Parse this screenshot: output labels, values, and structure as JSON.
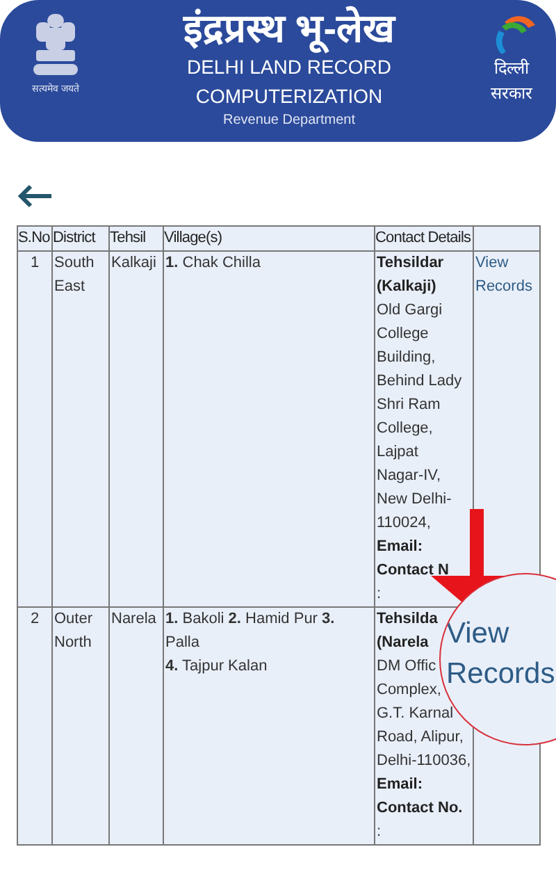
{
  "header": {
    "emblem_caption": "सत्यमेव जयते",
    "title_hindi": "इंद्रप्रस्थ भू-लेख",
    "title_lines": [
      "DELHI LAND RECORD",
      "COMPUTERIZATION"
    ],
    "subtitle": "Revenue Department",
    "logo_lines": [
      "दिल्ली",
      "सरकार"
    ]
  },
  "table": {
    "columns": [
      "S.No",
      "District",
      "Tehsil",
      "Village(s)",
      "Contact Details",
      ""
    ],
    "rows": [
      {
        "sno": "1",
        "district": "South East",
        "tehsil": "Kalkaji",
        "villages": [
          "**1.** Chak Chilla"
        ],
        "contact": [
          {
            "text": "Tehsildar",
            "bold": true
          },
          {
            "text": "(Kalkaji)",
            "bold": true
          },
          {
            "text": "Old Gargi",
            "bold": false
          },
          {
            "text": "College",
            "bold": false
          },
          {
            "text": "Building,",
            "bold": false
          },
          {
            "text": "Behind Lady",
            "bold": false
          },
          {
            "text": "Shri Ram",
            "bold": false
          },
          {
            "text": "College,",
            "bold": false
          },
          {
            "text": "Lajpat",
            "bold": false
          },
          {
            "text": "Nagar-IV,",
            "bold": false
          },
          {
            "text": "New Delhi-",
            "bold": false
          },
          {
            "text": "110024,",
            "bold": false
          },
          {
            "text": "Email:",
            "bold": true
          },
          {
            "text": "Contact N",
            "bold": true
          },
          {
            "text": ":",
            "bold": false
          }
        ],
        "link": "View Records"
      },
      {
        "sno": "2",
        "district": "Outer North",
        "tehsil": "Narela",
        "villages": [
          "**1.** Bakoli **2.** Hamid Pur **3.** Palla",
          "**4.** Tajpur Kalan"
        ],
        "contact": [
          {
            "text": "Tehsilda",
            "bold": true
          },
          {
            "text": "(Narela",
            "bold": true
          },
          {
            "text": "DM Offic",
            "bold": false
          },
          {
            "text": "Complex,",
            "bold": false
          },
          {
            "text": "G.T. Karnal",
            "bold": false
          },
          {
            "text": "Road, Alipur,",
            "bold": false
          },
          {
            "text": "Delhi-110036,",
            "bold": false
          },
          {
            "text": "Email:",
            "bold": true
          },
          {
            "text": "Contact No.",
            "bold": true
          },
          {
            "text": ":",
            "bold": false
          }
        ]
      }
    ]
  },
  "magnifier": {
    "text": "View Records"
  }
}
